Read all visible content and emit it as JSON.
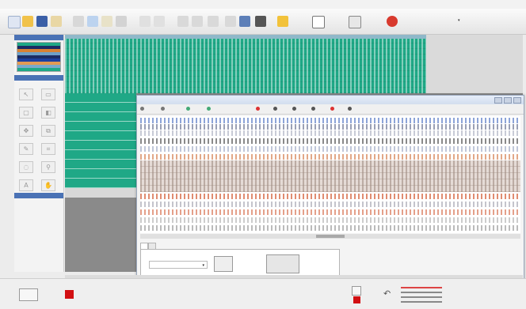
{
  "menu": [
    "",
    "",
    "",
    "",
    "",
    ""
  ],
  "toolbar": {
    "text_buttons": [
      {
        "label": "",
        "icon": "open-folder-icon"
      },
      {
        "label": "",
        "icon": "document-icon"
      },
      {
        "label": "",
        "icon": "grid-icon"
      },
      {
        "label": "",
        "icon": "globe-icon"
      }
    ]
  },
  "left_panel": {
    "palette_title": "",
    "tools_title": "",
    "properties_title": ""
  },
  "inner_window": {
    "title": "",
    "toolbar_items": [
      "",
      "",
      "",
      "",
      "",
      "",
      "",
      "",
      "",
      "",
      ""
    ]
  },
  "tabs": [
    "",
    ""
  ],
  "tab_panel": {
    "color_label": "",
    "select_value": "",
    "swatch_label": ""
  },
  "status": {
    "left_value": "",
    "red_label": "",
    "coords_line1": "",
    "coords_line2": "",
    "mini_labels": [
      "",
      ""
    ],
    "level_labels": [
      "",
      "",
      "",
      ""
    ]
  },
  "colors": {
    "teal": "#1fa886",
    "accent_red": "#d20f12",
    "title_blue": "#4a72b5"
  }
}
